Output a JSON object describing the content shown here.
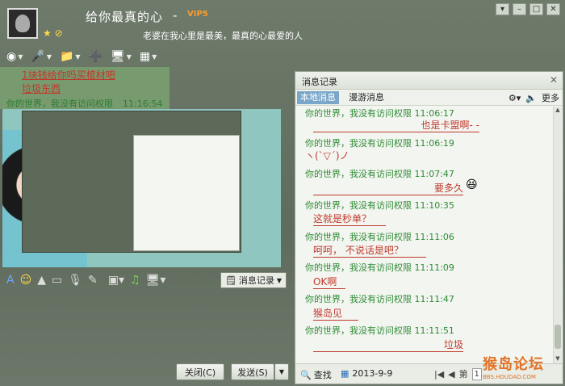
{
  "header": {
    "nickname": "给你最真的心",
    "dash": "-",
    "vip": "VIP5",
    "signature": "老婆在我心里是最美，最真的心最爱的人"
  },
  "chat": {
    "lines": [
      "1块钱给你吗买棺材吧",
      "垃圾东西"
    ],
    "sender": "你的世界，我没有访问权限",
    "time": "11:16:54"
  },
  "buttons": {
    "message_record": "消息记录",
    "close": "关闭(C)",
    "send": "发送(S)"
  },
  "log": {
    "title": "消息记录",
    "tabs": [
      "本地消息",
      "漫游消息"
    ],
    "more": "更多",
    "entries": [
      {
        "meta": "你的世界，我没有访问权限 11:06:17",
        "msg": "也是卡盟啊- -"
      },
      {
        "meta": "你的世界，我没有访问权限 11:06:19",
        "msg": "ヽ(ˋ▽ˊ)ノ"
      },
      {
        "meta": "你的世界，我没有访问权限 11:07:47",
        "msg": "要多久"
      },
      {
        "meta": "你的世界，我没有访问权限 11:10:35",
        "msg": "这就是秒单？"
      },
      {
        "meta": "你的世界，我没有访问权限 11:11:06",
        "msg": "呵呵， 不说话是吧？"
      },
      {
        "meta": "你的世界，我没有访问权限 11:11:09",
        "msg": "OK啊"
      },
      {
        "meta": "你的世界，我没有访问权限 11:11:47",
        "msg": "猴岛见"
      },
      {
        "meta": "你的世界，我没有访问权限 11:11:51",
        "msg": "垃圾"
      }
    ],
    "search": "查找",
    "date": "2013-9-9",
    "page_label": "第",
    "page_value": "1"
  },
  "watermark": {
    "line1": "猴岛论坛",
    "line2": "BBS.HOUDAO.COM"
  }
}
